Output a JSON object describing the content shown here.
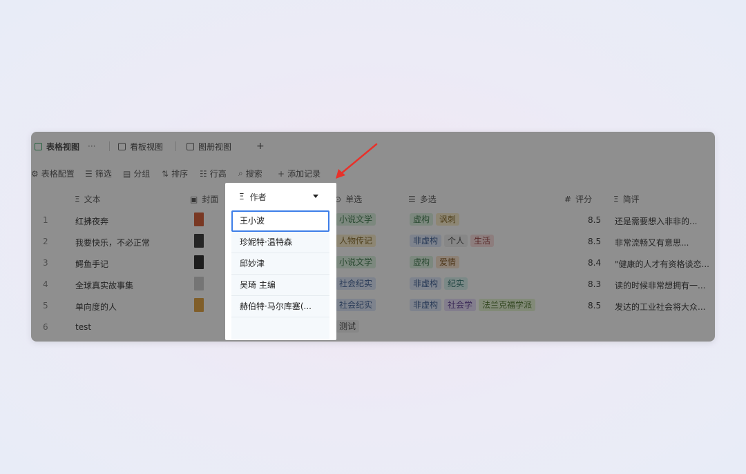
{
  "tabs": [
    {
      "label": "表格视图"
    },
    {
      "label": "看板视图"
    },
    {
      "label": "图册视图"
    }
  ],
  "tab_more": "···",
  "tab_add": "+",
  "actions": [
    {
      "icon": "settings-icon",
      "glyph": "⚙",
      "label": "表格配置"
    },
    {
      "icon": "filter-icon",
      "glyph": "☰",
      "label": "筛选"
    },
    {
      "icon": "group-icon",
      "glyph": "▤",
      "label": "分组"
    },
    {
      "icon": "sort-icon",
      "glyph": "⇅",
      "label": "排序"
    },
    {
      "icon": "row-height-icon",
      "glyph": "☷",
      "label": "行高"
    },
    {
      "icon": "search-icon",
      "glyph": "⌕",
      "label": "搜索"
    },
    {
      "icon": "add-icon",
      "glyph": "+",
      "label": "添加记录"
    }
  ],
  "columns": {
    "text": "文本",
    "cover": "封面",
    "author": "作者",
    "single": "单选",
    "multi": "多选",
    "score": "评分",
    "review": "简评"
  },
  "rows": [
    {
      "n": "1",
      "text": "红拂夜奔",
      "single": "小说文学",
      "multi": [
        "虚构",
        "讽刺"
      ],
      "score": "8.5",
      "review": "还是需要想入非非的..."
    },
    {
      "n": "2",
      "text": "我要快乐，不必正常",
      "single": "人物传记",
      "multi": [
        "非虚构",
        "个人",
        "生活"
      ],
      "score": "8.5",
      "review": "非常流畅又有意思..."
    },
    {
      "n": "3",
      "text": "鳄鱼手记",
      "single": "小说文学",
      "multi": [
        "虚构",
        "爱情"
      ],
      "score": "8.4",
      "review": "\"健康的人才有资格谈恋..."
    },
    {
      "n": "4",
      "text": "全球真实故事集",
      "single": "社会纪实",
      "multi": [
        "非虚构",
        "纪实"
      ],
      "score": "8.3",
      "review": "读的时候非常想拥有一..."
    },
    {
      "n": "5",
      "text": "单向度的人",
      "single": "社会纪实",
      "multi": [
        "非虚构",
        "社会学",
        "法兰克福学派"
      ],
      "score": "8.5",
      "review": "发达的工业社会将大众..."
    },
    {
      "n": "6",
      "text": "test",
      "single": "测试",
      "multi": [],
      "score": "",
      "review": ""
    }
  ],
  "author_options": [
    "王小波",
    "珍妮特·温特森",
    "邱妙津",
    "吴琦 主编",
    "赫伯特·马尔库塞(..."
  ]
}
